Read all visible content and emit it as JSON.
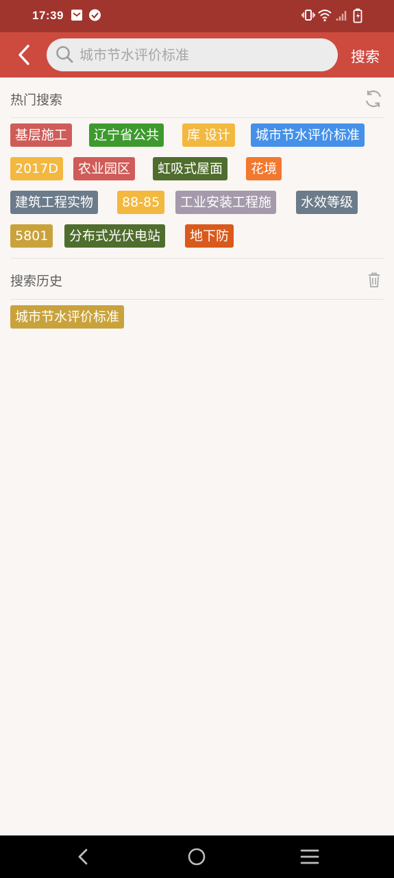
{
  "status_bar": {
    "time": "17:39"
  },
  "header": {
    "search_placeholder": "城市节水评价标准",
    "search_label": "搜索"
  },
  "hot": {
    "title": "热门搜索",
    "tags": [
      {
        "label": "基层施工",
        "color": "#cf5c58"
      },
      {
        "label": "辽宁省公共",
        "color": "#3e9a2f"
      },
      {
        "label": "库 设计",
        "color": "#f3b840"
      },
      {
        "label": "城市节水评价标准",
        "color": "#4590e8"
      },
      {
        "label": "2017D",
        "color": "#f3b840"
      },
      {
        "label": "农业园区",
        "color": "#cf5c58"
      },
      {
        "label": "虹吸式屋面",
        "color": "#4f6d2d"
      },
      {
        "label": "花境",
        "color": "#f1782f"
      },
      {
        "label": "建筑工程实物",
        "color": "#6b7b8a"
      },
      {
        "label": "88-85",
        "color": "#f3b840"
      },
      {
        "label": "工业安装工程施",
        "color": "#a59aac"
      },
      {
        "label": "水效等级",
        "color": "#6b7b8a"
      },
      {
        "label": "5801",
        "color": "#c9a23c"
      },
      {
        "label": "分布式光伏电站",
        "color": "#4f6d2d"
      },
      {
        "label": "地下防",
        "color": "#d95a1c"
      }
    ]
  },
  "history": {
    "title": "搜索历史",
    "tags": [
      {
        "label": "城市节水评价标准",
        "color": "#c9a23c"
      }
    ]
  }
}
